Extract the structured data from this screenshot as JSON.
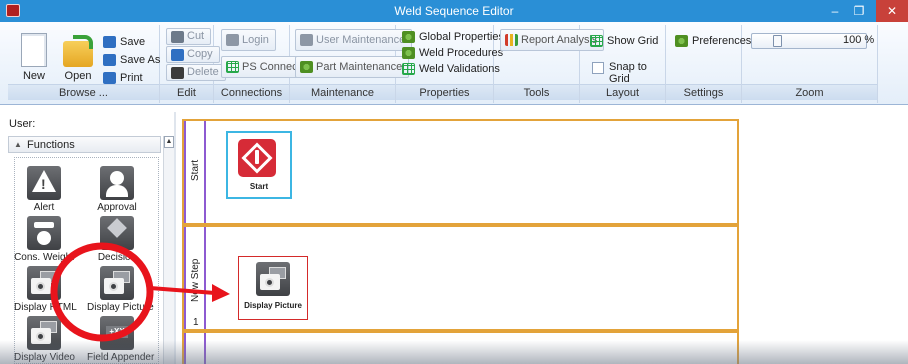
{
  "window": {
    "title": "Weld Sequence Editor",
    "controls": [
      "–",
      "❐",
      "✕"
    ]
  },
  "ribbon": {
    "browse": {
      "label": "Browse ...",
      "new": "New",
      "open": "Open",
      "save": "Save",
      "save_as": "Save As",
      "print": "Print"
    },
    "edit": {
      "label": "Edit",
      "cut": "Cut",
      "copy": "Copy",
      "delete": "Delete"
    },
    "connections": {
      "label": "Connections",
      "login": "Login",
      "ps_connect": "PS Connect"
    },
    "maintenance": {
      "label": "Maintenance",
      "user_maintenance": "User Maintenance",
      "part_maintenance": "Part Maintenance"
    },
    "properties": {
      "label": "Properties",
      "global_properties": "Global Properties",
      "weld_procedures": "Weld Procedures",
      "weld_validations": "Weld Validations"
    },
    "tools": {
      "label": "Tools",
      "report_analysis": "Report Analysis"
    },
    "layout": {
      "label": "Layout",
      "show_grid": "Show Grid",
      "snap_to_grid": "Snap to Grid"
    },
    "settings": {
      "label": "Settings",
      "preferences": "Preferences"
    },
    "zoom": {
      "label": "Zoom",
      "value": "100 %",
      "level_fraction": 0.2
    }
  },
  "left_panel": {
    "user_label": "User:",
    "functions_header": "Functions",
    "tools": [
      "Alert",
      "Approval",
      "Cons. Weight",
      "Decision",
      "Display HTML",
      "Display Picture",
      "Display Video",
      "Field Appender"
    ]
  },
  "canvas": {
    "lanes": [
      {
        "title": "Start",
        "number": ""
      },
      {
        "title": "New Step",
        "number": "1"
      }
    ],
    "nodes": {
      "start": "Start",
      "display_picture": "Display Picture"
    }
  },
  "colors": {
    "titlebar": "#2a8fd6",
    "lane_border": "#e3a33a",
    "lane_header": "#8d5ad1",
    "annotation": "#e8141c",
    "start_node_border": "#3cb6e3",
    "picture_node_border": "#d42a2a"
  }
}
